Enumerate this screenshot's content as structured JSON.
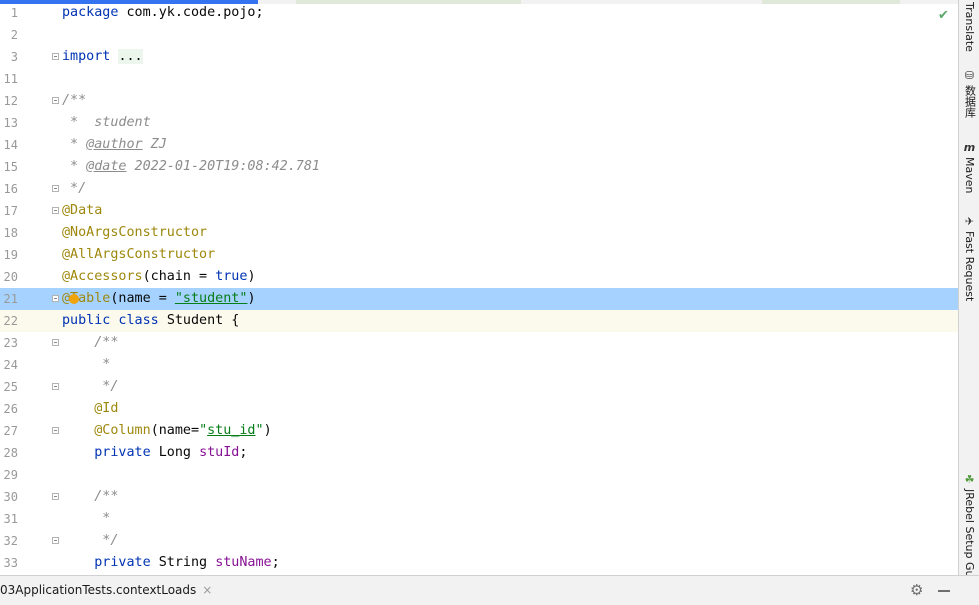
{
  "editor": {
    "lines": [
      {
        "n": "1",
        "state": "normal",
        "fold": false,
        "segs": [
          {
            "t": "package ",
            "c": "kw"
          },
          {
            "t": "com.yk.code.pojo;",
            "c": ""
          }
        ]
      },
      {
        "n": "2",
        "state": "normal",
        "fold": false,
        "segs": []
      },
      {
        "n": "3",
        "state": "normal",
        "fold": true,
        "segs": [
          {
            "t": "import ",
            "c": "kw"
          },
          {
            "t": "...",
            "c": "fldbox"
          }
        ]
      },
      {
        "n": "11",
        "state": "normal",
        "fold": false,
        "segs": []
      },
      {
        "n": "12",
        "state": "normal",
        "fold": true,
        "segs": [
          {
            "t": "/**",
            "c": "cmt"
          }
        ]
      },
      {
        "n": "13",
        "state": "normal",
        "fold": false,
        "segs": [
          {
            "t": " *  student",
            "c": "cmt"
          }
        ]
      },
      {
        "n": "14",
        "state": "normal",
        "fold": false,
        "segs": [
          {
            "t": " * ",
            "c": "cmt"
          },
          {
            "t": "@author",
            "c": "tag"
          },
          {
            "t": " ZJ",
            "c": "cmt"
          }
        ]
      },
      {
        "n": "15",
        "state": "normal",
        "fold": false,
        "segs": [
          {
            "t": " * ",
            "c": "cmt"
          },
          {
            "t": "@date",
            "c": "tag"
          },
          {
            "t": " 2022-01-20T19:08:42.781",
            "c": "cmt"
          }
        ]
      },
      {
        "n": "16",
        "state": "normal",
        "fold": true,
        "segs": [
          {
            "t": " */",
            "c": "cmt"
          }
        ]
      },
      {
        "n": "17",
        "state": "normal",
        "fold": true,
        "segs": [
          {
            "t": "@Data",
            "c": "ann"
          }
        ]
      },
      {
        "n": "18",
        "state": "normal",
        "fold": false,
        "segs": [
          {
            "t": "@NoArgsConstructor",
            "c": "ann"
          }
        ]
      },
      {
        "n": "19",
        "state": "normal",
        "fold": false,
        "segs": [
          {
            "t": "@AllArgsConstructor",
            "c": "ann"
          }
        ]
      },
      {
        "n": "20",
        "state": "normal",
        "fold": false,
        "segs": [
          {
            "t": "@Accessors",
            "c": "ann"
          },
          {
            "t": "(chain = ",
            "c": ""
          },
          {
            "t": "true",
            "c": "kw"
          },
          {
            "t": ")",
            "c": ""
          }
        ]
      },
      {
        "n": "21",
        "state": "selected",
        "fold": true,
        "bulb": true,
        "segs": [
          {
            "t": "@Table",
            "c": "ann"
          },
          {
            "t": "(name = ",
            "c": ""
          },
          {
            "t": "\"student\"",
            "c": "strul"
          },
          {
            "t": ")",
            "c": ""
          }
        ]
      },
      {
        "n": "22",
        "state": "current",
        "fold": false,
        "segs": [
          {
            "t": "public class ",
            "c": "kw"
          },
          {
            "t": "Student {",
            "c": ""
          }
        ]
      },
      {
        "n": "23",
        "state": "normal",
        "fold": true,
        "segs": [
          {
            "t": "    /**",
            "c": "cmt"
          }
        ]
      },
      {
        "n": "24",
        "state": "normal",
        "fold": false,
        "segs": [
          {
            "t": "     *",
            "c": "cmt"
          }
        ]
      },
      {
        "n": "25",
        "state": "normal",
        "fold": true,
        "segs": [
          {
            "t": "     */",
            "c": "cmt"
          }
        ]
      },
      {
        "n": "26",
        "state": "normal",
        "fold": false,
        "segs": [
          {
            "t": "    ",
            "c": ""
          },
          {
            "t": "@Id",
            "c": "ann"
          }
        ]
      },
      {
        "n": "27",
        "state": "normal",
        "fold": true,
        "segs": [
          {
            "t": "    ",
            "c": ""
          },
          {
            "t": "@Column",
            "c": "ann"
          },
          {
            "t": "(name=",
            "c": ""
          },
          {
            "t": "\"",
            "c": "str"
          },
          {
            "t": "stu_id",
            "c": "strul"
          },
          {
            "t": "\"",
            "c": "str"
          },
          {
            "t": ")",
            "c": ""
          }
        ]
      },
      {
        "n": "28",
        "state": "normal",
        "fold": false,
        "segs": [
          {
            "t": "    ",
            "c": ""
          },
          {
            "t": "private ",
            "c": "kw"
          },
          {
            "t": "Long ",
            "c": ""
          },
          {
            "t": "stuId",
            "c": "fld"
          },
          {
            "t": ";",
            "c": ""
          }
        ]
      },
      {
        "n": "29",
        "state": "normal",
        "fold": false,
        "segs": []
      },
      {
        "n": "30",
        "state": "normal",
        "fold": true,
        "segs": [
          {
            "t": "    /**",
            "c": "cmt"
          }
        ]
      },
      {
        "n": "31",
        "state": "normal",
        "fold": false,
        "segs": [
          {
            "t": "     *",
            "c": "cmt"
          }
        ]
      },
      {
        "n": "32",
        "state": "normal",
        "fold": true,
        "segs": [
          {
            "t": "     */",
            "c": "cmt"
          }
        ]
      },
      {
        "n": "33",
        "state": "normal",
        "fold": false,
        "segs": [
          {
            "t": "    ",
            "c": ""
          },
          {
            "t": "private ",
            "c": "kw"
          },
          {
            "t": "String ",
            "c": ""
          },
          {
            "t": "stuName",
            "c": "fld"
          },
          {
            "t": ";",
            "c": ""
          }
        ]
      }
    ]
  },
  "right_panel": {
    "tabs": [
      {
        "label": "Translate",
        "icon": "translate-icon",
        "glyph": ""
      },
      {
        "label": "数据库",
        "icon": "database-icon",
        "glyph": "⛁"
      },
      {
        "label": "Maven",
        "icon": "maven-icon",
        "glyph": "m"
      },
      {
        "label": "Fast Request",
        "icon": "rocket-icon",
        "glyph": "✈"
      },
      {
        "label": "JRebel Setup Guide",
        "icon": "jrebel-icon",
        "glyph": "☘"
      }
    ]
  },
  "bottom_bar": {
    "run_tab_label": "03ApplicationTests.contextLoads",
    "close_glyph": "×",
    "gear_glyph": "⚙"
  },
  "status": {
    "check_glyph": "✔"
  },
  "colors": {
    "selection": "#a6d2ff",
    "current_line": "#fcfaed",
    "keyword": "#0033b3",
    "annotation": "#9e880d",
    "string": "#067d17",
    "field": "#871094",
    "comment": "#8c8c8c"
  }
}
